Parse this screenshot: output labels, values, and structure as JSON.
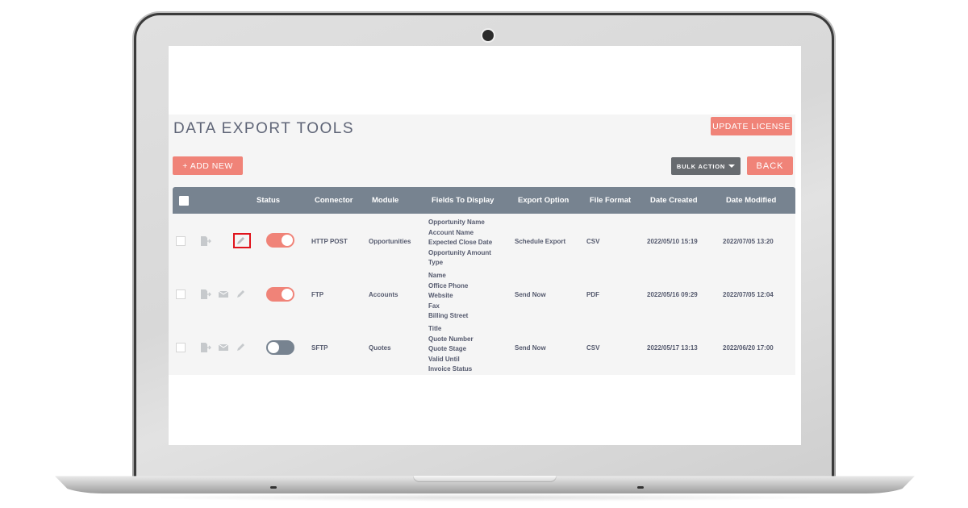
{
  "page": {
    "title": "DATA EXPORT TOOLS"
  },
  "toolbar": {
    "update_license_label": "UPDATE LICENSE",
    "add_new_label": "+ ADD NEW",
    "bulk_action_label": "BULK ACTION",
    "back_label": "BACK"
  },
  "table": {
    "columns": [
      "Status",
      "Connector",
      "Module",
      "Fields To Display",
      "Export Option",
      "File Format",
      "Date Created",
      "Date Modified"
    ],
    "rows": [
      {
        "status_on": true,
        "connector": "HTTP POST",
        "module": "Opportunities",
        "fields": [
          "Opportunity Name",
          "Account Name",
          "Expected Close Date",
          "Opportunity Amount",
          "Type"
        ],
        "export_option": "Schedule Export",
        "file_format": "CSV",
        "date_created": "2022/05/10 15:19",
        "date_modified": "2022/07/05 13:20",
        "icons": [
          "export-icon",
          "edit-icon"
        ],
        "highlighted": "edit-icon"
      },
      {
        "status_on": true,
        "connector": "FTP",
        "module": "Accounts",
        "fields": [
          "Name",
          "Office Phone",
          "Website",
          "Fax",
          "Billing Street"
        ],
        "export_option": "Send Now",
        "file_format": "PDF",
        "date_created": "2022/05/16 09:29",
        "date_modified": "2022/07/05 12:04",
        "icons": [
          "export-icon",
          "email-icon",
          "edit-icon"
        ]
      },
      {
        "status_on": false,
        "connector": "SFTP",
        "module": "Quotes",
        "fields": [
          "Title",
          "Quote Number",
          "Quote Stage",
          "Valid Until",
          "Invoice Status"
        ],
        "export_option": "Send Now",
        "file_format": "CSV",
        "date_created": "2022/05/17 13:13",
        "date_modified": "2022/06/20 17:00",
        "icons": [
          "export-icon",
          "email-icon",
          "edit-icon"
        ]
      }
    ]
  },
  "colors": {
    "accent": "#f08378",
    "table_header": "#778390",
    "bulk_action": "#676b6f",
    "highlight": "#e0141c"
  }
}
